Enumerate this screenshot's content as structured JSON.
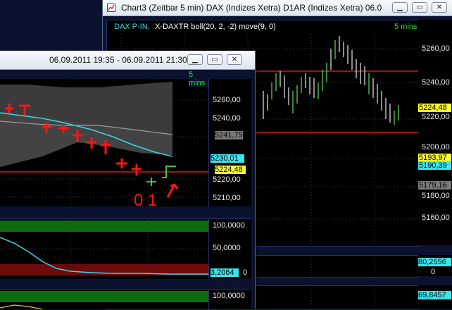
{
  "right_window": {
    "title": "Chart3 (Zeitbar 5 min)  DAX (Indizes Xetra) D1AR (Indizes Xetra) 06.09...",
    "legend_symbol": "DAX P-IN.",
    "legend_indicator": "X-DAXTR boll(20, 2, -2) move(9, 0)",
    "interval": "5 mins",
    "price_ticks": [
      "5260,00",
      "5240,00",
      "5220,00",
      "5200,00",
      "5180,00",
      "5160,00"
    ],
    "tag_last": "5224,48",
    "tag_a": "5193,97",
    "tag_b": "5190,39",
    "tag_c": "5179,16",
    "sub1_value": "80,2556",
    "sub1_zero": "0",
    "sub2_value": "69,8457"
  },
  "left_window": {
    "title": "06.09.2011 19:35 - 06.09.2011 21:30",
    "interval": "5 mins",
    "price_ticks": [
      "5260,00",
      "5240,00",
      "5220,00",
      "5210,00"
    ],
    "tag_upper": "5241,75",
    "tag_ma": "5230,01",
    "tag_last": "5224,48",
    "sub1_ticks": [
      "100,0000",
      "50,0000"
    ],
    "sub1_value": "3,2064",
    "sub1_zero": "0",
    "sub2_ticks": [
      "100,0000"
    ],
    "annotation": "0 1"
  },
  "colors": {
    "chart_bg": "#000000",
    "panel_bg": "#0b1230",
    "band_fill": "#3b3b3b",
    "red_line": "#d21818",
    "cyan_line": "#38d6e6",
    "green_zone": "#0e6b0e",
    "red_zone": "#6e0a0a",
    "annotation": "#ff1414",
    "tag_yellow": "#ffff2a",
    "tag_cyan": "#39e6ee",
    "tag_gray": "#7a7a7a"
  },
  "icons": [
    "chart-icon",
    "minimize-icon",
    "maximize-icon",
    "close-icon"
  ]
}
